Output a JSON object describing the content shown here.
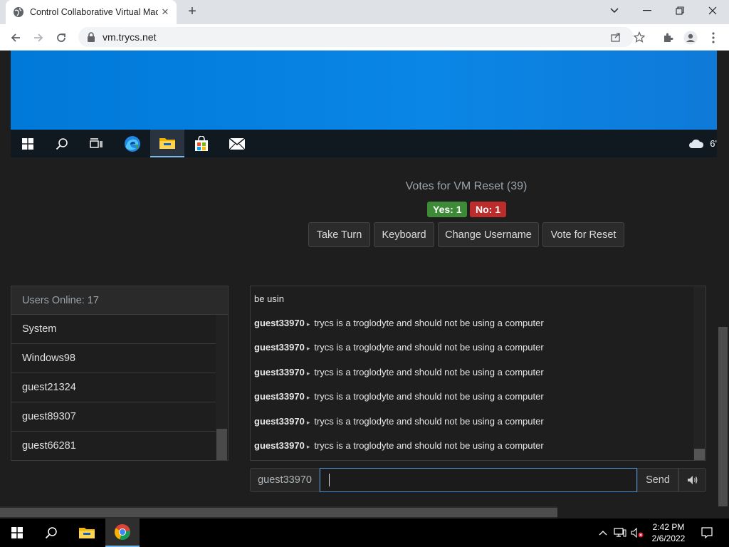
{
  "browser": {
    "tab_title": "Control Collaborative Virtual Mac",
    "url": "vm.trycs.net"
  },
  "vm": {
    "weather_text": "6'"
  },
  "votes": {
    "title": "Votes for VM Reset (39)",
    "yes": "Yes: 1",
    "no": "No: 1"
  },
  "buttons": {
    "take_turn": "Take Turn",
    "keyboard": "Keyboard",
    "change_username": "Change Username",
    "vote_reset": "Vote for Reset"
  },
  "users": {
    "header": "Users Online: 17",
    "list": [
      "System",
      "Windows98",
      "guest21324",
      "guest89307",
      "guest66281"
    ]
  },
  "chat": {
    "messages": [
      {
        "user": "",
        "text": "be usin"
      },
      {
        "user": "guest33970",
        "text": "trycs is a troglodyte and should not be using a computer"
      },
      {
        "user": "guest33970",
        "text": "trycs is a troglodyte and should not be using a computer"
      },
      {
        "user": "guest33970",
        "text": "trycs is a troglodyte and should not be using a computer"
      },
      {
        "user": "guest33970",
        "text": "trycs is a troglodyte and should not be using a computer"
      },
      {
        "user": "guest33970",
        "text": "trycs is a troglodyte and should not be using a computer"
      },
      {
        "user": "guest33970",
        "text": "trycs is a troglodyte and should not be using a computer"
      }
    ],
    "username": "guest33970",
    "input_value": "",
    "send_label": "Send"
  },
  "taskbar": {
    "time": "2:42 PM",
    "date": "2/6/2022"
  }
}
